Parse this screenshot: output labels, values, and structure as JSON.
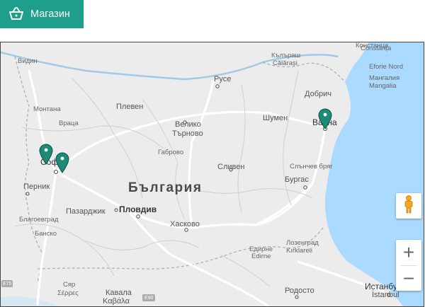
{
  "shop": {
    "label": "Магазин",
    "icon": "basket-icon"
  },
  "map": {
    "country_label": "България",
    "cities": {
      "sofia": "София",
      "pernik": "Перник",
      "plovdiv": "Пловдив",
      "varna": "Варна",
      "burgas": "Бургас",
      "ruse": "Русе",
      "pleven": "Плевен",
      "veliko1": "Велико",
      "veliko2": "Търново",
      "shumen": "Шумен",
      "dobrich": "Добрич",
      "haskovo": "Хасково",
      "pazardzhik": "Пазарджик",
      "sliven": "Сливен",
      "gabrovo": "Габрово",
      "montana": "Монтана",
      "vratsa": "Враца",
      "vidin": "Видин",
      "blagoevgrad": "Благоевград",
      "bansko": "Банско",
      "slanchev": "Слънчев бряг",
      "kalarash": "Кълъраш",
      "calarasi": "Călărași",
      "constanta_bg": "Констанца",
      "constanta": "Constanța",
      "eforie": "Eforie Nord",
      "mangalia_bg": "Мангалия",
      "mangalia": "Mangalia",
      "edirne_bg": "Едирне",
      "edirne": "Edirne",
      "kirklareli_bg": "Лозенград",
      "kirklareli": "Kırklareli",
      "rodosto": "Родосто",
      "istanbul": "Истанбул",
      "istanbul_lat": "İstanbul",
      "kavala_bg": "Кавала",
      "kavala": "Καβάλα",
      "serres_bg": "Сяр",
      "serres": "Σέρρες",
      "e90": "E90",
      "e75": "E75"
    },
    "markers": [
      {
        "name": "marker-sofia-1",
        "color": "#1e8a78"
      },
      {
        "name": "marker-sofia-2",
        "color": "#1e8a78"
      },
      {
        "name": "marker-varna",
        "color": "#1e8a78"
      }
    ],
    "controls": {
      "zoom_in": "+",
      "zoom_out": "−",
      "pegman_icon": "pegman-icon"
    },
    "colors": {
      "sea": "#aadaff",
      "land": "#ececec",
      "accent": "#1e9e8b"
    }
  }
}
